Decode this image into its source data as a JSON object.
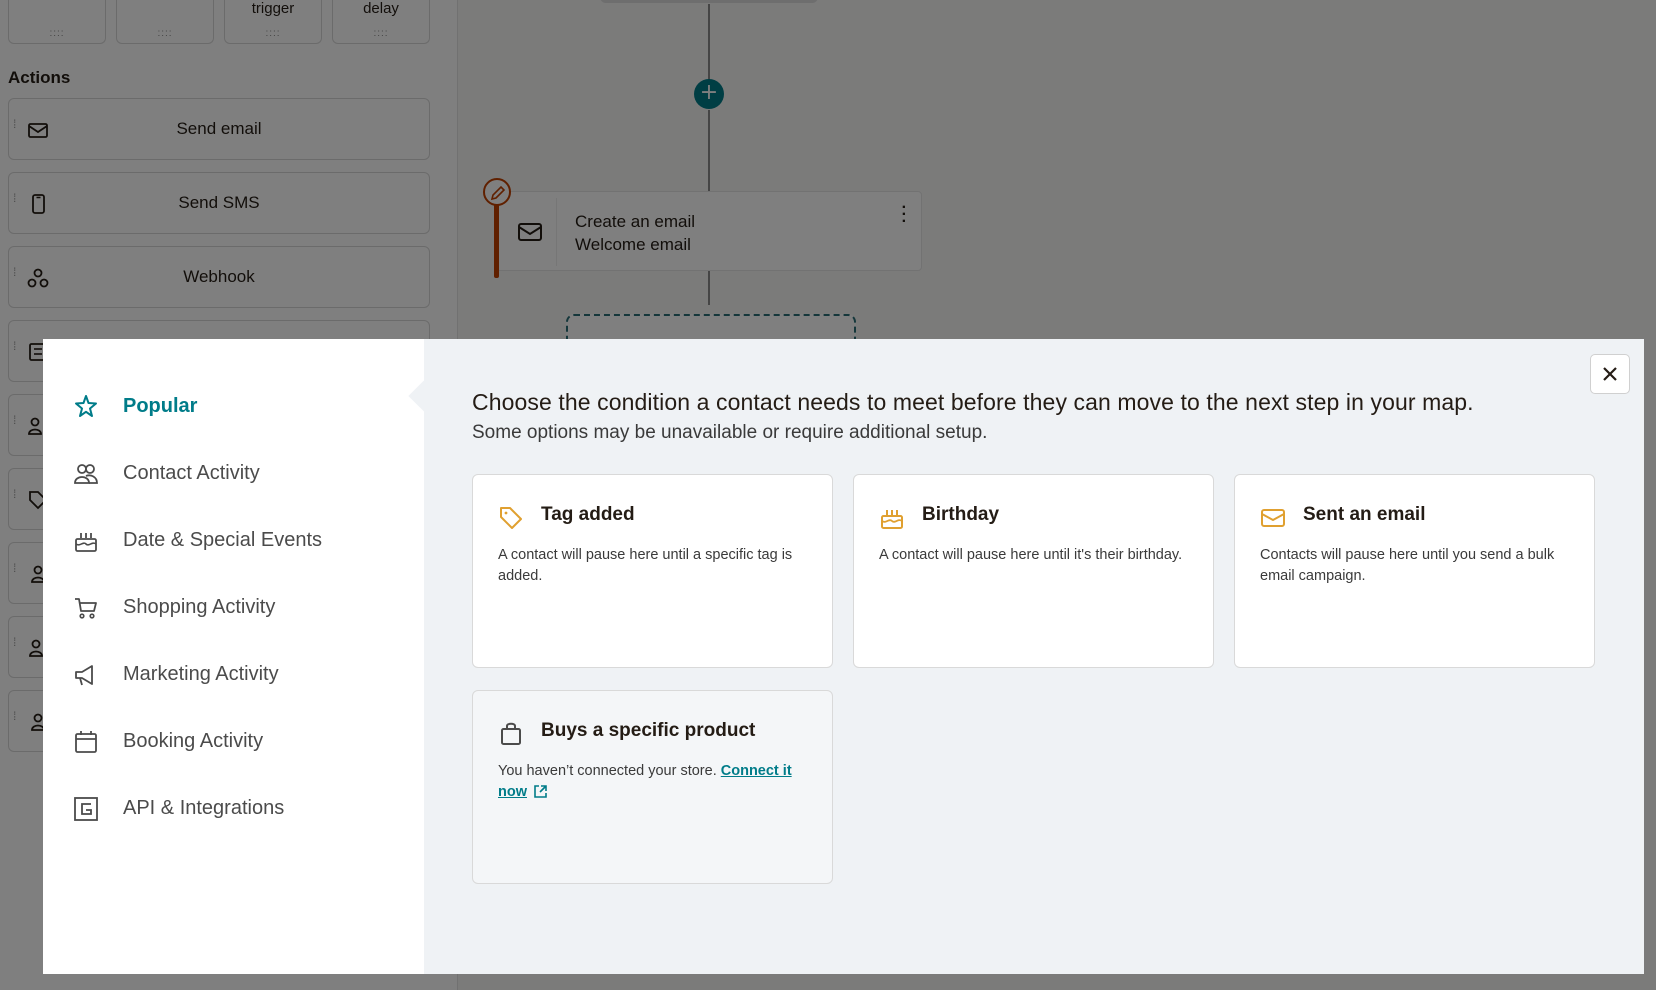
{
  "background": {
    "triggers": [
      {
        "label": ""
      },
      {
        "label": ""
      },
      {
        "label": "trigger"
      },
      {
        "label": "delay"
      }
    ],
    "actions_heading": "Actions",
    "actions": [
      {
        "label": "Send email",
        "icon": "envelope-icon"
      },
      {
        "label": "Send SMS",
        "icon": "phone-icon"
      },
      {
        "label": "Webhook",
        "icon": "webhook-icon"
      },
      {
        "label": "",
        "icon": "checklist-icon"
      },
      {
        "label": "",
        "icon": "contacts-icon"
      },
      {
        "label": "",
        "icon": "tag-icon"
      },
      {
        "label": "",
        "icon": "person-icon"
      },
      {
        "label": "",
        "icon": "person-edit-icon"
      },
      {
        "label": "",
        "icon": "person-icon"
      }
    ],
    "step": {
      "title": "Create an email",
      "subtitle": "Welcome email"
    }
  },
  "modal": {
    "nav": [
      {
        "label": "Popular",
        "icon": "star-icon",
        "active": true
      },
      {
        "label": "Contact Activity",
        "icon": "contacts-icon",
        "active": false
      },
      {
        "label": "Date & Special Events",
        "icon": "cake-icon",
        "active": false
      },
      {
        "label": "Shopping Activity",
        "icon": "cart-icon",
        "active": false
      },
      {
        "label": "Marketing Activity",
        "icon": "megaphone-icon",
        "active": false
      },
      {
        "label": "Booking Activity",
        "icon": "calendar-icon",
        "active": false
      },
      {
        "label": "API & Integrations",
        "icon": "api-icon",
        "active": false
      }
    ],
    "title": "Choose the condition a contact needs to meet before they can move to the next step in your map.",
    "subtitle": "Some options may be unavailable or require additional setup.",
    "cards": [
      {
        "title": "Tag added",
        "description": "A contact will pause here until a specific tag is added.",
        "icon": "tag-icon",
        "enabled": true
      },
      {
        "title": "Birthday",
        "description": "A contact will pause here until it's their birthday.",
        "icon": "cake-icon",
        "enabled": true
      },
      {
        "title": "Sent an email",
        "description": "Contacts will pause here until you send a bulk email campaign.",
        "icon": "envelope-icon",
        "enabled": true
      },
      {
        "title": "Buys a specific product",
        "description": "You haven’t connected your store.",
        "link": "Connect it now",
        "icon": "shopping-bag-icon",
        "enabled": false
      }
    ],
    "colors": {
      "accent": "#007c89",
      "card_icon": "#e0a030",
      "step_bar": "#c04000"
    }
  }
}
